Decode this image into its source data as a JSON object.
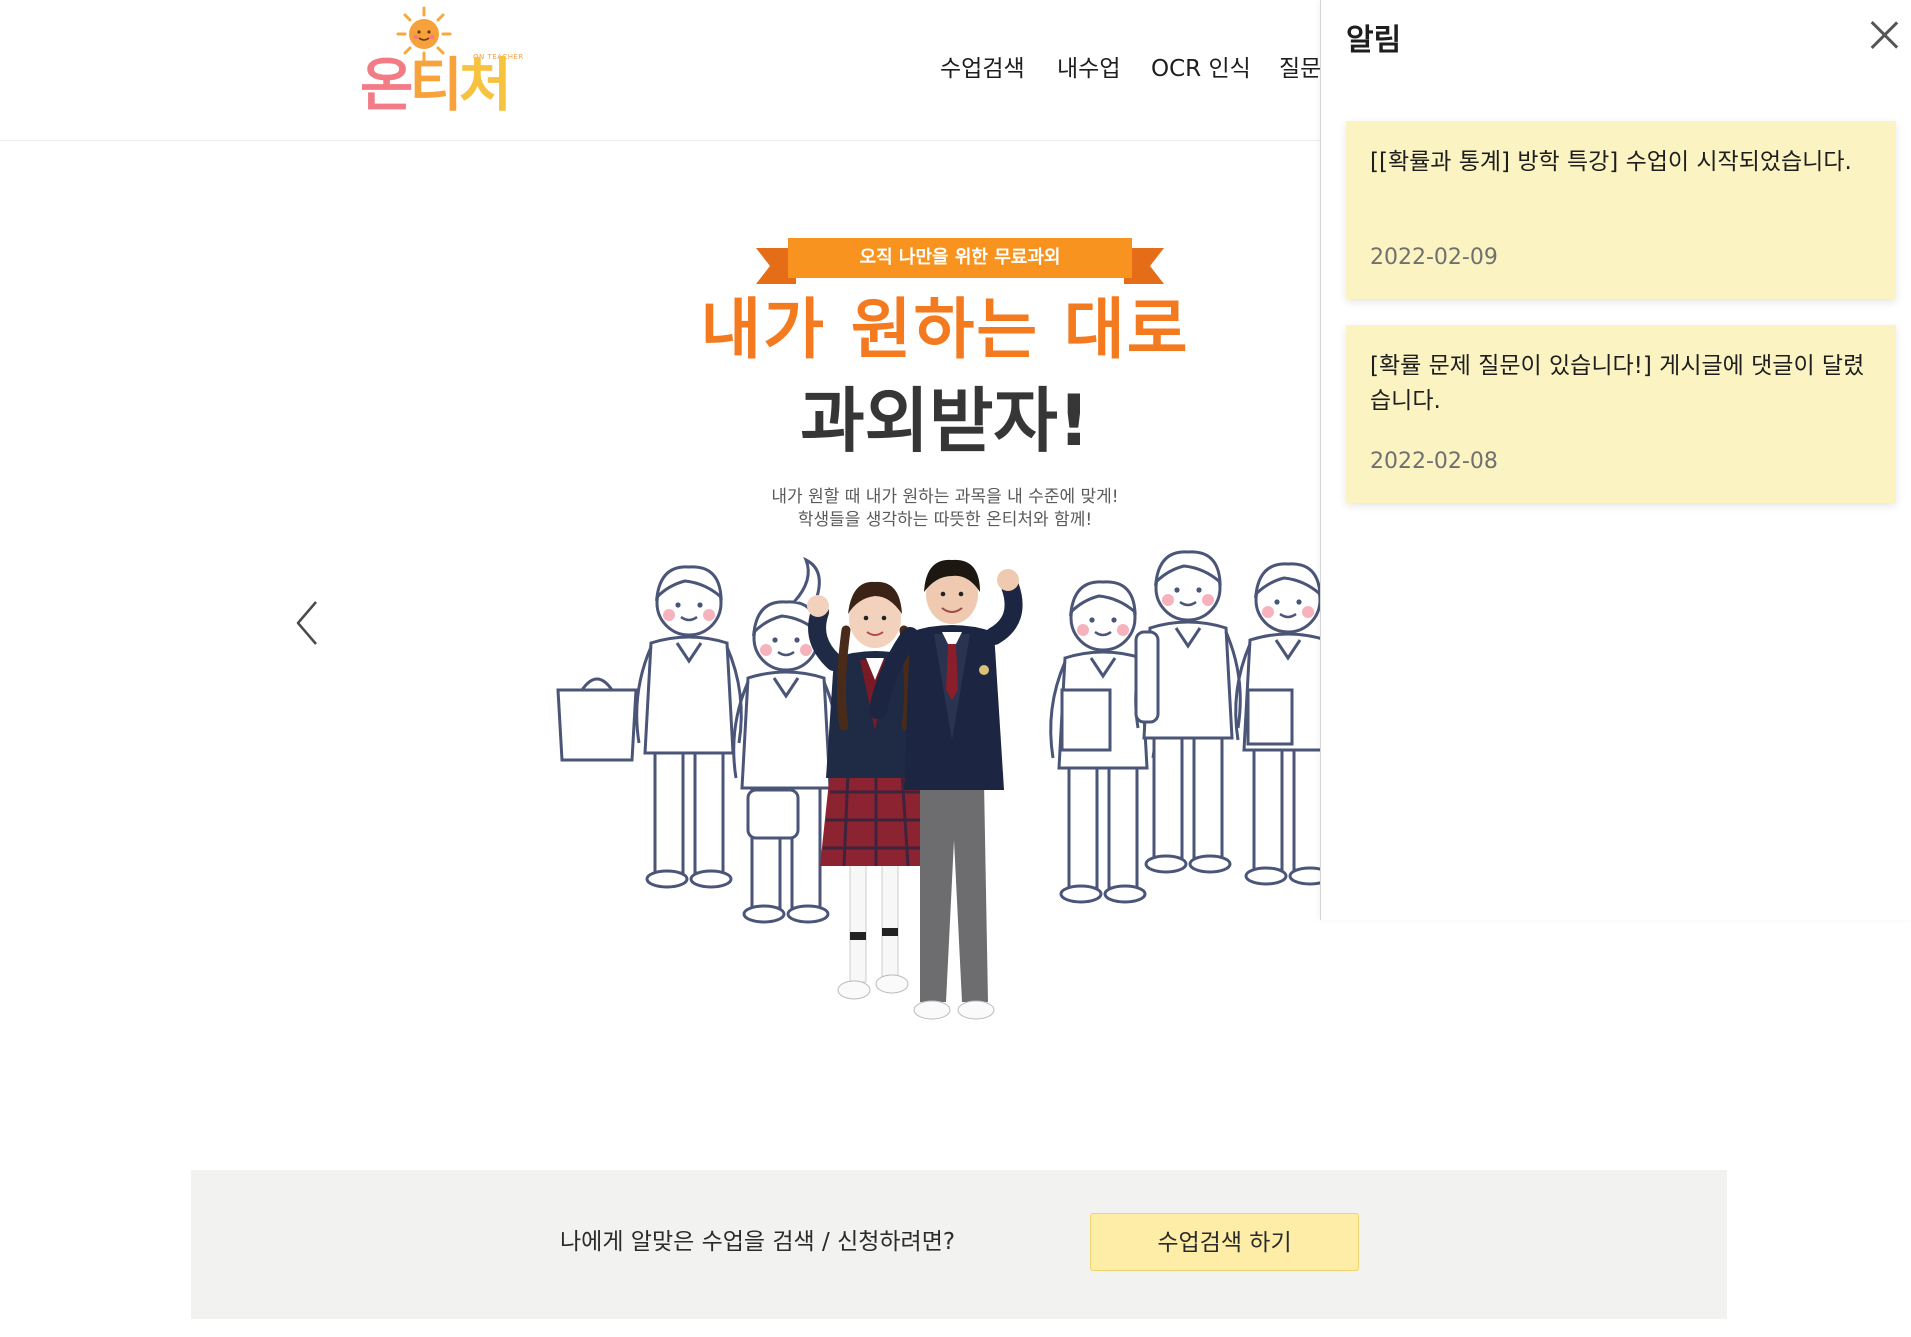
{
  "header": {
    "logo": {
      "chars": [
        "온",
        "티",
        "처"
      ],
      "subtitle": "ON TEACHER"
    },
    "nav": [
      {
        "label": "수업검색"
      },
      {
        "label": "내수업"
      },
      {
        "label": "OCR 인식"
      },
      {
        "label": "질문"
      }
    ]
  },
  "banner": {
    "ribbon": "오직 나만을 위한 무료과외",
    "headline_1": "내가 원하는 대로",
    "headline_2": "과외받자!",
    "desc_1": "내가 원할 때 내가 원하는 과목을 내 수준에 맞게!",
    "desc_2": "학생들을 생각하는 따뜻한 온티처와 함께!",
    "prev_icon": "chevron-left-icon"
  },
  "cta": {
    "text": "나에게 알맞은 수업을 검색 / 신청하려면?",
    "button": "수업검색 하기"
  },
  "notifications": {
    "title": "알림",
    "close_icon": "close-icon",
    "items": [
      {
        "message": "[[확률과 통계] 방학 특강] 수업이 시작되었습니다.",
        "date": "2022-02-09"
      },
      {
        "message": "[확률 문제 질문이 있습니다!] 게시글에 댓글이 달렸습니다.",
        "date": "2022-02-08"
      }
    ]
  },
  "colors": {
    "card_background": "#fbf4c2",
    "cta_button": "#fdeda6",
    "headline_orange": "#f47a1f",
    "cta_background": "#f2f2f0"
  }
}
